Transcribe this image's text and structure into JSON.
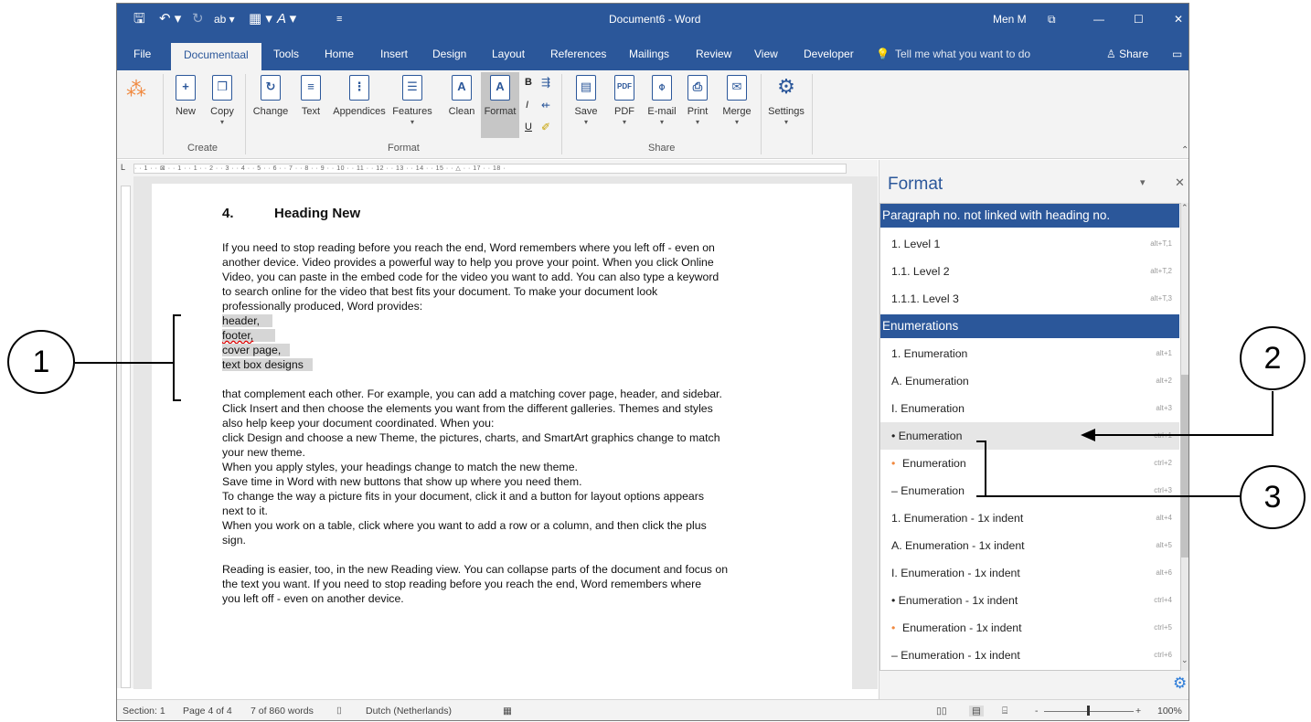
{
  "titlebar": {
    "qat_save": "🖫",
    "qat_undo": "↶ ▾",
    "qat_redo": "↻",
    "qat_highlight": "ab ▾",
    "qat_table": "▦ ▾",
    "qat_format": "A ▾",
    "qat_more": "≡",
    "doc_title": "Document6 - Word",
    "user": "Men M",
    "display_options": "⧉",
    "minimize": "—",
    "maximize": "☐",
    "close": "✕"
  },
  "tabs": {
    "file": "File",
    "documentaal": "Documentaal",
    "tools": "Tools",
    "home": "Home",
    "insert": "Insert",
    "design": "Design",
    "layout": "Layout",
    "references": "References",
    "mailings": "Mailings",
    "review": "Review",
    "view": "View",
    "developer": "Developer",
    "tell_me": "Tell me what you want to do",
    "share": "Share"
  },
  "ribbon": {
    "new": "New",
    "copy": "Copy",
    "change": "Change",
    "text": "Text",
    "appendices": "Appendices",
    "features": "Features",
    "clean": "Clean",
    "format": "Format",
    "save": "Save",
    "pdf": "PDF",
    "email": "E-mail",
    "print": "Print",
    "merge": "Merge",
    "settings": "Settings",
    "group_create": "Create",
    "group_format": "Format",
    "group_share": "Share",
    "bold": "B",
    "italic": "I",
    "underline": "U"
  },
  "ruler": {
    "h_ticks": "· · 1 · · ⊠ · · 1 · · 1 · · 2 · · 3 · · 4 · · 5 · · 6 · · 7 · · 8 · · 9 · · 10 · · 11 · · 12 · · 13 · · 14 · · 15 · · △ · · 17 · · 18 ·"
  },
  "document": {
    "heading_num": "4.",
    "heading_text": "Heading New",
    "p1_l1": "If you need to stop reading before you reach the end, Word remembers where you left off - even on",
    "p1_l2": "another device. Video provides a powerful way to help you prove your point. When you click Online",
    "p1_l3": "Video, you can paste in the embed code for the video you want to add. You can also type a keyword",
    "p1_l4": "to search online for the video that best fits your document. To make your document look",
    "p1_l5": "professionally produced, Word provides:",
    "hl1": "header,",
    "hl2": "footer,",
    "hl3": "cover page,",
    "hl4": "text box designs",
    "p2_l1": "that complement each other. For example, you can add a matching cover page, header, and sidebar.",
    "p2_l2": "Click Insert and then choose the elements you want from the different galleries. Themes and styles",
    "p2_l3": "also help keep your document coordinated. When you:",
    "p2_l4": "click Design and choose a new Theme, the pictures, charts, and SmartArt graphics change to match",
    "p2_l5": "your new theme.",
    "p2_l6": "When you apply styles, your headings change to match the new theme.",
    "p2_l7": "Save time in Word with new buttons that show up where you need them.",
    "p2_l8": "To change the way a picture fits in your document, click it and a button for layout options appears",
    "p2_l9": "next to it.",
    "p2_l10": "When you work on a table, click where you want to add a row or a column, and then click the plus",
    "p2_l11": "sign.",
    "p3_l1": "Reading is easier, too, in the new Reading view. You can collapse parts of the document and focus on",
    "p3_l2": "the text you want. If you need to stop reading before you reach the end, Word remembers where",
    "p3_l3": "you left off - even on another device."
  },
  "pane": {
    "title": "Format",
    "dropdown": "▾",
    "close": "✕",
    "gear": "⚙",
    "scroll_up": "⌃",
    "scroll_down": "⌄",
    "header1": "Paragraph no. not linked with heading no.",
    "header2": "Enumerations",
    "items": [
      {
        "label": "1. Level 1",
        "shortcut": "alt+T,1"
      },
      {
        "label": "1.1. Level 2",
        "shortcut": "alt+T,2"
      },
      {
        "label": "1.1.1. Level 3",
        "shortcut": "alt+T,3"
      },
      {
        "label": "1. Enumeration",
        "shortcut": "alt+1"
      },
      {
        "label": "A. Enumeration",
        "shortcut": "alt+2"
      },
      {
        "label": "I. Enumeration",
        "shortcut": "alt+3"
      },
      {
        "label": "• Enumeration",
        "shortcut": "ctrl+1"
      },
      {
        "label": "Enumeration",
        "shortcut": "ctrl+2"
      },
      {
        "label": "– Enumeration",
        "shortcut": "ctrl+3"
      },
      {
        "label": "1. Enumeration - 1x indent",
        "shortcut": "alt+4"
      },
      {
        "label": "A. Enumeration - 1x indent",
        "shortcut": "alt+5"
      },
      {
        "label": "I. Enumeration - 1x indent",
        "shortcut": "alt+6"
      },
      {
        "label": "• Enumeration - 1x indent",
        "shortcut": "ctrl+4"
      },
      {
        "label": "Enumeration - 1x indent",
        "shortcut": "ctrl+5"
      },
      {
        "label": "– Enumeration - 1x indent",
        "shortcut": "ctrl+6"
      }
    ]
  },
  "status": {
    "section": "Section: 1",
    "page": "Page 4 of 4",
    "words": "7 of 860 words",
    "proof_icon": "⌷",
    "language": "Dutch (Netherlands)",
    "macro_icon": "▦",
    "zoom_minus": "-",
    "zoom_plus": "+",
    "zoom": "100%"
  },
  "callouts": {
    "c1": "1",
    "c2": "2",
    "c3": "3"
  },
  "colors": {
    "word_blue": "#2b579a",
    "orange_bullet": "#f0883e"
  }
}
